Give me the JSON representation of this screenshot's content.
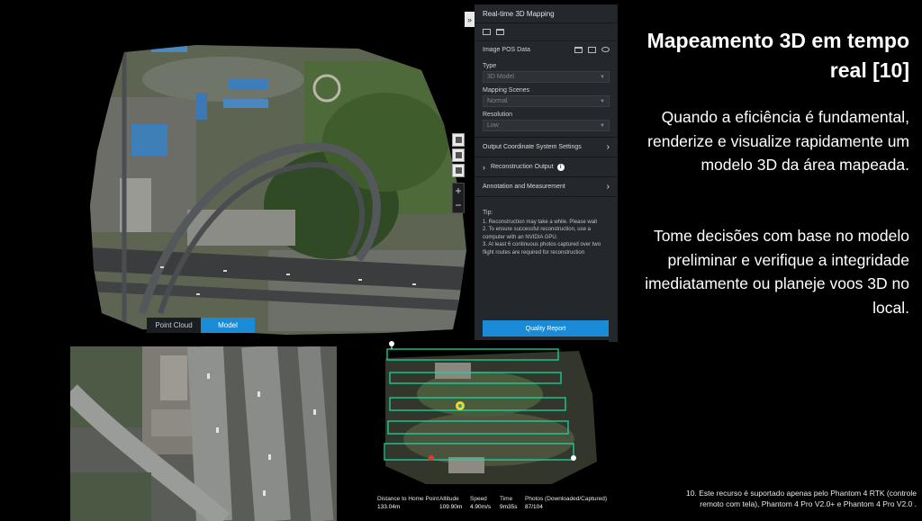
{
  "slide": {
    "title": "Mapeamento 3D em tempo real [10]",
    "paragraph_1": "Quando a eficiência é fundamental, renderize e visualize rapidamente um modelo 3D da área mapeada.",
    "paragraph_2": "Tome decisões com base no modelo preliminar e verifique a integridade imediatamente ou planeje voos 3D no local.",
    "footnote": "10. Este recurso é suportado apenas pelo Phantom 4 RTK (controle remoto com tela), Phantom 4 Pro V2.0+ e Phantom 4 Pro V2.0 ."
  },
  "viewer": {
    "toggle": {
      "point_cloud": "Point Cloud",
      "model": "Model",
      "active": "Model"
    },
    "collapse_glyph": "»",
    "zoom_in": "+",
    "zoom_out": "−"
  },
  "panel": {
    "title": "Real-time 3D Mapping",
    "pos_data_label": "Image POS Data",
    "type_label": "Type",
    "type_value": "3D Model",
    "scenes_label": "Mapping Scenes",
    "scenes_value": "Normal",
    "resolution_label": "Resolution",
    "resolution_value": "Low",
    "output_coord": "Output Coordinate System Settings",
    "recon_output": "Reconstruction Output",
    "annotation": "Annotation and Measurement",
    "tip_title": "Tip:",
    "tips": [
      "1. Reconstruction may take a while. Please wait",
      "2. To ensure successful reconstruction, use a computer with an NVIDIA GPU.",
      "3. At least 6 continuous photos captured over two flight routes are required for reconstruction"
    ],
    "quality_button": "Quality Report"
  },
  "telemetry": [
    {
      "label": "Distance to Home Point",
      "value": "133.04m"
    },
    {
      "label": "Altitude",
      "value": "109.90m"
    },
    {
      "label": "Speed",
      "value": "4.90m/s"
    },
    {
      "label": "Time",
      "value": "9m35s"
    },
    {
      "label": "Photos (Downloaded/Captured)",
      "value": "87/104"
    }
  ],
  "colors": {
    "accent_blue": "#1a8bd6",
    "panel_bg": "#24272c",
    "flight_route": "#19d6a0"
  }
}
